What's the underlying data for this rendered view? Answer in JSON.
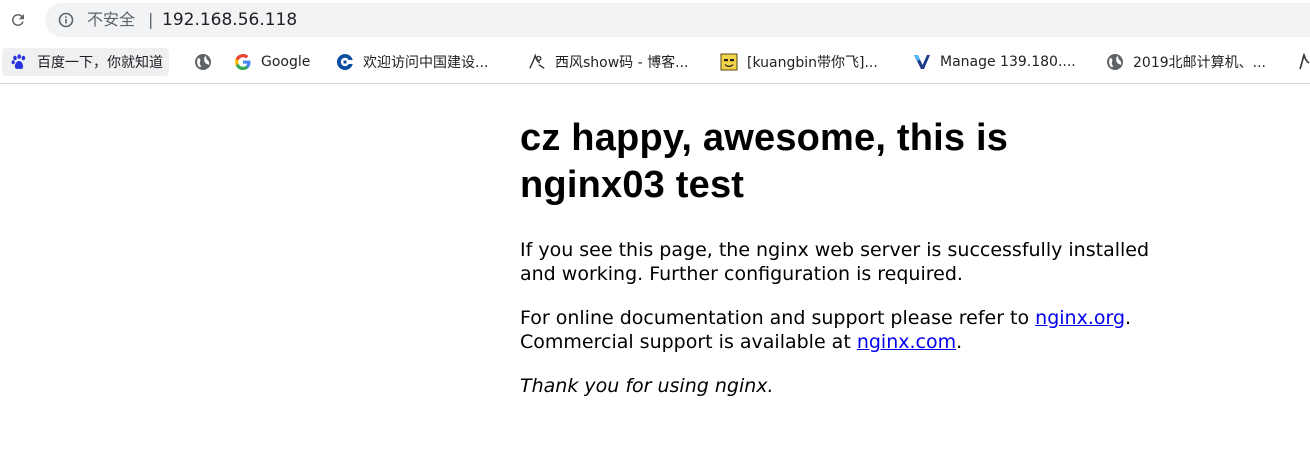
{
  "browser": {
    "security_label": "不安全",
    "separator": "|",
    "url": "192.168.56.118"
  },
  "bookmarks": [
    {
      "label": "百度一下，你就知道",
      "icon": "baidu-paw-icon"
    },
    {
      "label": "",
      "icon": "globe-icon"
    },
    {
      "label": "Google",
      "icon": "google-g-icon"
    },
    {
      "label": "欢迎访问中国建设...",
      "icon": "ccb-icon"
    },
    {
      "label": "西风show码 - 博客...",
      "icon": "cnblogs-icon"
    },
    {
      "label": "[kuangbin带你飞]...",
      "icon": "smiley-icon"
    },
    {
      "label": "Manage 139.180....",
      "icon": "vultr-v-icon"
    },
    {
      "label": "2019北邮计算机、...",
      "icon": "globe-icon"
    }
  ],
  "page": {
    "heading": "cz happy, awesome, this is nginx03 test",
    "intro": "If you see this page, the nginx web server is successfully installed and working. Further configuration is required.",
    "support_prefix": "For online documentation and support please refer to ",
    "link_org": "nginx.org",
    "support_middle": ".",
    "commercial_prefix": "Commercial support is available at ",
    "link_com": "nginx.com",
    "support_suffix": ".",
    "thanks": "Thank you for using nginx."
  },
  "colors": {
    "omnibox_bg": "#f1f3f4",
    "link": "#0000ee",
    "baidu_blue": "#2932e1",
    "ccb_blue": "#0a4ea2",
    "vultr_blue": "#1e3a8a"
  }
}
